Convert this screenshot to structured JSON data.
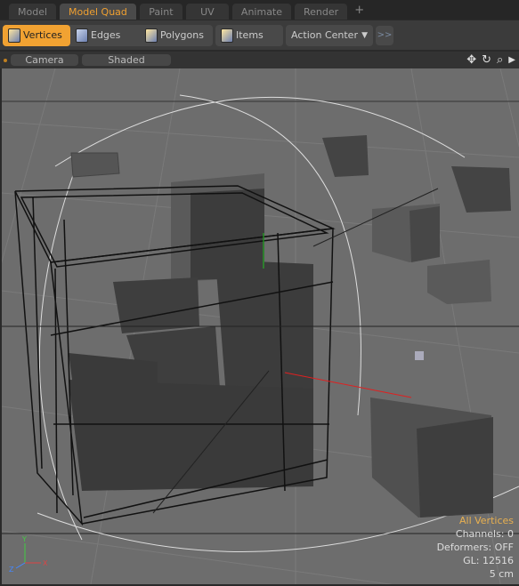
{
  "tabs": [
    {
      "label": "Model"
    },
    {
      "label": "Model Quad",
      "active": true
    },
    {
      "label": "Paint"
    },
    {
      "label": "UV"
    },
    {
      "label": "Animate"
    },
    {
      "label": "Render"
    }
  ],
  "tab_add": "+",
  "toolbar": {
    "vertices": "Vertices",
    "edges": "Edges",
    "polygons": "Polygons",
    "items": "Items",
    "action_center": "Action Center",
    "more": ">>"
  },
  "viewport": {
    "camera": "Camera",
    "shading": "Shaded",
    "icons": [
      "move-icon",
      "rotate-icon",
      "zoom-icon",
      "expand-arrow-icon"
    ],
    "info": {
      "selection": "All Vertices",
      "channels": "Channels: 0",
      "deformers": "Deformers: OFF",
      "gl": "GL: 12516",
      "scale": "5 cm"
    },
    "axis_labels": {
      "y": "Y",
      "x": "X",
      "z": "Z"
    }
  },
  "colors": {
    "accent": "#f1a232",
    "viewport_bg": "#6d6d6d",
    "x_axis": "#e02020",
    "y_axis": "#20c020"
  }
}
